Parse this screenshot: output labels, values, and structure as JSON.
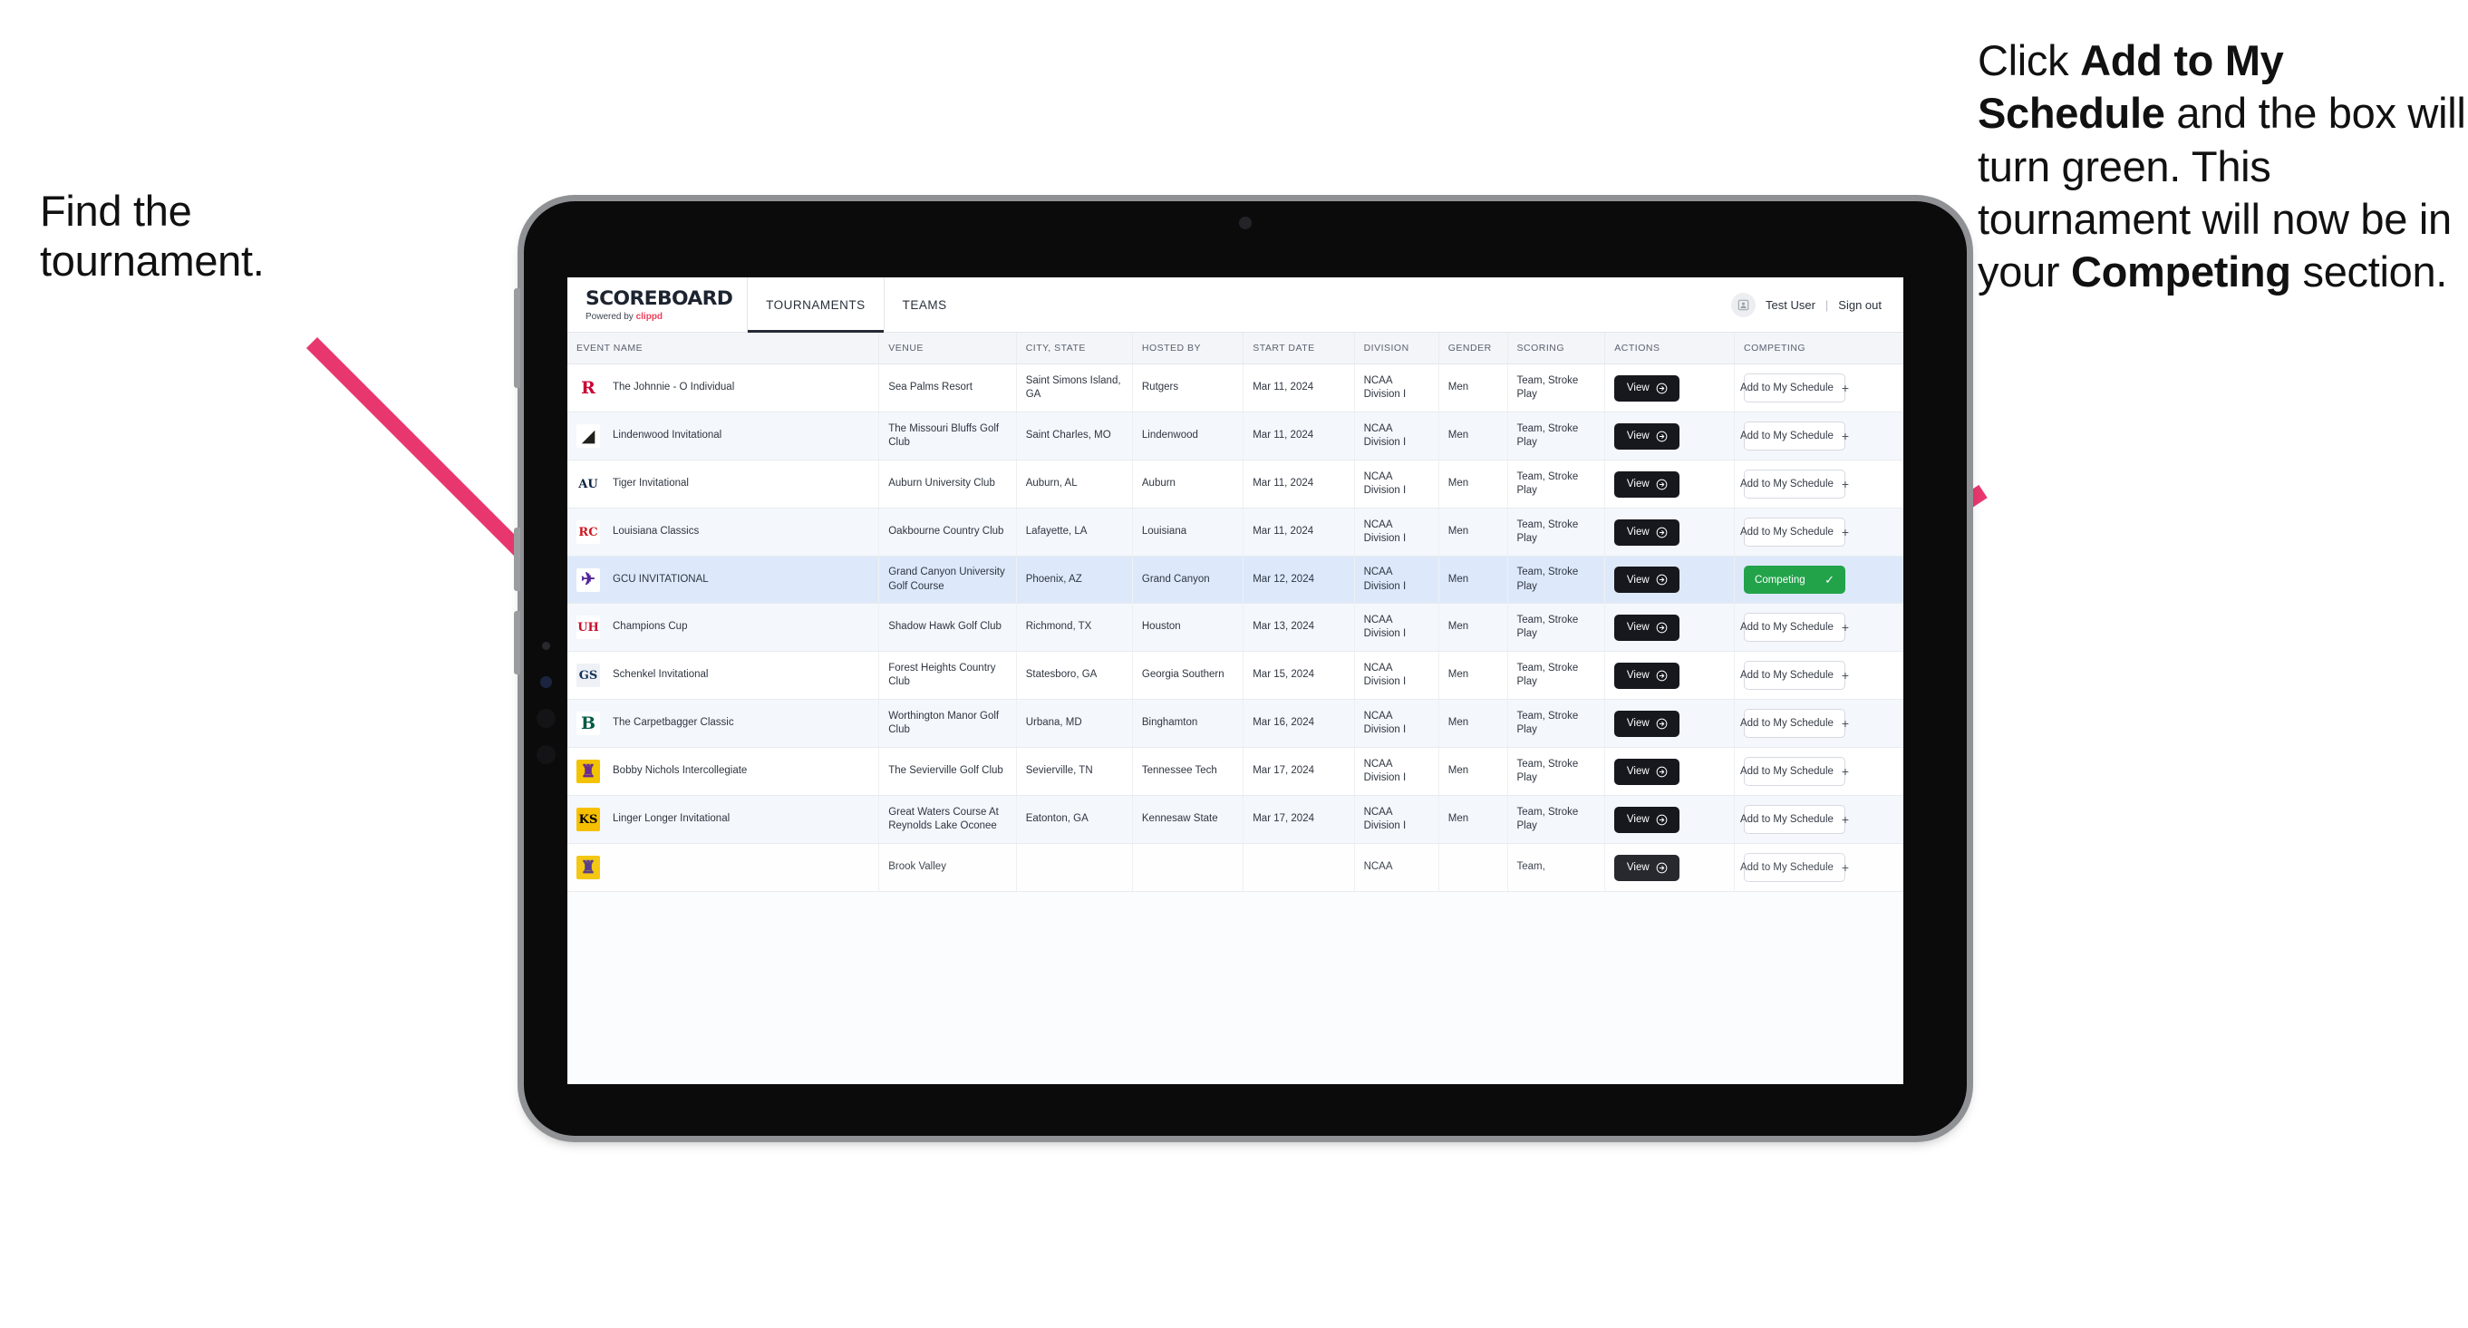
{
  "annotations": {
    "left": {
      "line1": "Find the",
      "line2": "tournament."
    },
    "right": {
      "seg1": "Click ",
      "bold1": "Add to My Schedule",
      "seg2": " and the box will turn green. This tournament will now be in your ",
      "bold2": "Competing",
      "seg3": " section."
    },
    "arrow_color": "#e8376f"
  },
  "app": {
    "brand": {
      "title": "SCOREBOARD",
      "powered_prefix": "Powered by ",
      "powered_brand": "clippd"
    },
    "nav": {
      "tabs": [
        {
          "label": "TOURNAMENTS",
          "active": true
        },
        {
          "label": "TEAMS",
          "active": false
        }
      ]
    },
    "user": {
      "name": "Test User",
      "divider": "|",
      "sign_out": "Sign out"
    },
    "table": {
      "columns": [
        "EVENT NAME",
        "VENUE",
        "CITY, STATE",
        "HOSTED BY",
        "START DATE",
        "DIVISION",
        "GENDER",
        "SCORING",
        "ACTIONS",
        "COMPETING"
      ],
      "view_label": "View",
      "add_label": "Add to My Schedule",
      "competing_label": "Competing",
      "rows": [
        {
          "event": "The Johnnie - O Individual",
          "venue": "Sea Palms Resort",
          "city": "Saint Simons Island, GA",
          "host": "Rutgers",
          "date": "Mar 11, 2024",
          "division": "NCAA Division I",
          "gender": "Men",
          "scoring": "Team, Stroke Play",
          "competing": false,
          "logo": {
            "glyph": "R",
            "color": "#cc0033",
            "bg": "#ffffff"
          }
        },
        {
          "event": "Lindenwood Invitational",
          "venue": "The Missouri Bluffs Golf Club",
          "city": "Saint Charles, MO",
          "host": "Lindenwood",
          "date": "Mar 11, 2024",
          "division": "NCAA Division I",
          "gender": "Men",
          "scoring": "Team, Stroke Play",
          "competing": false,
          "logo": {
            "glyph": "◢",
            "color": "#20201c",
            "bg": "#ffffff"
          }
        },
        {
          "event": "Tiger Invitational",
          "venue": "Auburn University Club",
          "city": "Auburn, AL",
          "host": "Auburn",
          "date": "Mar 11, 2024",
          "division": "NCAA Division I",
          "gender": "Men",
          "scoring": "Team, Stroke Play",
          "competing": false,
          "logo": {
            "glyph": "AU",
            "color": "#0c2340",
            "bg": "#ffffff"
          }
        },
        {
          "event": "Louisiana Classics",
          "venue": "Oakbourne Country Club",
          "city": "Lafayette, LA",
          "host": "Louisiana",
          "date": "Mar 11, 2024",
          "division": "NCAA Division I",
          "gender": "Men",
          "scoring": "Team, Stroke Play",
          "competing": false,
          "logo": {
            "glyph": "RC",
            "color": "#ce181e",
            "bg": "#ffffff"
          }
        },
        {
          "event": "GCU INVITATIONAL",
          "venue": "Grand Canyon University Golf Course",
          "city": "Phoenix, AZ",
          "host": "Grand Canyon",
          "date": "Mar 12, 2024",
          "division": "NCAA Division I",
          "gender": "Men",
          "scoring": "Team, Stroke Play",
          "competing": true,
          "selected": true,
          "logo": {
            "glyph": "✈",
            "color": "#522398",
            "bg": "#ffffff"
          }
        },
        {
          "event": "Champions Cup",
          "venue": "Shadow Hawk Golf Club",
          "city": "Richmond, TX",
          "host": "Houston",
          "date": "Mar 13, 2024",
          "division": "NCAA Division I",
          "gender": "Men",
          "scoring": "Team, Stroke Play",
          "competing": false,
          "logo": {
            "glyph": "UH",
            "color": "#c8102e",
            "bg": "#ffffff"
          }
        },
        {
          "event": "Schenkel Invitational",
          "venue": "Forest Heights Country Club",
          "city": "Statesboro, GA",
          "host": "Georgia Southern",
          "date": "Mar 15, 2024",
          "division": "NCAA Division I",
          "gender": "Men",
          "scoring": "Team, Stroke Play",
          "competing": false,
          "logo": {
            "glyph": "GS",
            "color": "#12315c",
            "bg": "#eef1f5"
          }
        },
        {
          "event": "The Carpetbagger Classic",
          "venue": "Worthington Manor Golf Club",
          "city": "Urbana, MD",
          "host": "Binghamton",
          "date": "Mar 16, 2024",
          "division": "NCAA Division I",
          "gender": "Men",
          "scoring": "Team, Stroke Play",
          "competing": false,
          "logo": {
            "glyph": "B",
            "color": "#005a43",
            "bg": "#ffffff"
          }
        },
        {
          "event": "Bobby Nichols Intercollegiate",
          "venue": "The Sevierville Golf Club",
          "city": "Sevierville, TN",
          "host": "Tennessee Tech",
          "date": "Mar 17, 2024",
          "division": "NCAA Division I",
          "gender": "Men",
          "scoring": "Team, Stroke Play",
          "competing": false,
          "logo": {
            "glyph": "♜",
            "color": "#6a2d8f",
            "bg": "#f3c300"
          }
        },
        {
          "event": "Linger Longer Invitational",
          "venue": "Great Waters Course At Reynolds Lake Oconee",
          "city": "Eatonton, GA",
          "host": "Kennesaw State",
          "date": "Mar 17, 2024",
          "division": "NCAA Division I",
          "gender": "Men",
          "scoring": "Team, Stroke Play",
          "competing": false,
          "logo": {
            "glyph": "KS",
            "color": "#000000",
            "bg": "#f6c000"
          }
        },
        {
          "event": "",
          "venue": "Brook Valley",
          "city": "",
          "host": "",
          "date": "",
          "division": "NCAA",
          "gender": "",
          "scoring": "Team,",
          "competing": false,
          "cut_off": true,
          "logo": {
            "glyph": "♜",
            "color": "#4b2e83",
            "bg": "#f3c300"
          }
        }
      ]
    }
  }
}
